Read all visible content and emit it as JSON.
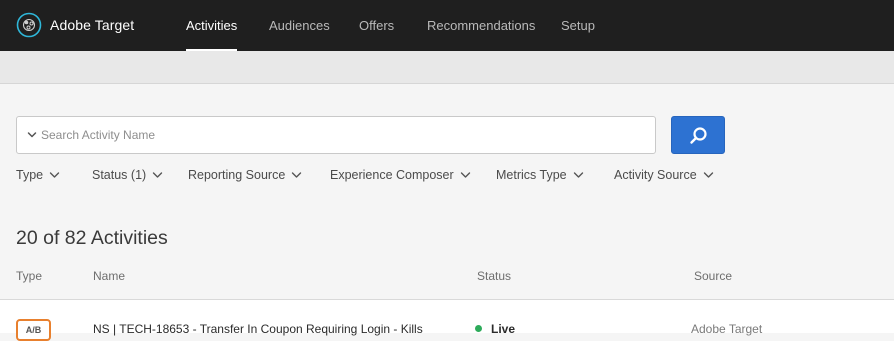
{
  "app": {
    "title": "Adobe Target",
    "logo_icon": "adobe-target-logo"
  },
  "nav": {
    "items": [
      {
        "label": "Activities",
        "active": true
      },
      {
        "label": "Audiences",
        "active": false
      },
      {
        "label": "Offers",
        "active": false
      },
      {
        "label": "Recommendations",
        "active": false
      },
      {
        "label": "Setup",
        "active": false
      }
    ]
  },
  "search": {
    "placeholder": "Search Activity Name",
    "value": "",
    "button_icon": "search-icon"
  },
  "filters": [
    {
      "label": "Type"
    },
    {
      "label": "Status (1)"
    },
    {
      "label": "Reporting Source"
    },
    {
      "label": "Experience Composer"
    },
    {
      "label": "Metrics Type"
    },
    {
      "label": "Activity Source"
    }
  ],
  "results": {
    "count_text": "20 of 82 Activities"
  },
  "table": {
    "columns": {
      "type": "Type",
      "name": "Name",
      "status": "Status",
      "source": "Source"
    },
    "rows": [
      {
        "type": "A/B",
        "name": "NS | TECH-18653 - Transfer In Coupon Requiring Login - Kills",
        "status": "Live",
        "source": "Adobe Target"
      }
    ]
  },
  "colors": {
    "topbar": "#1f1f1f",
    "accent": "#2d72d2",
    "badge_ab": "#e8802e",
    "status_live": "#2dab5a"
  }
}
